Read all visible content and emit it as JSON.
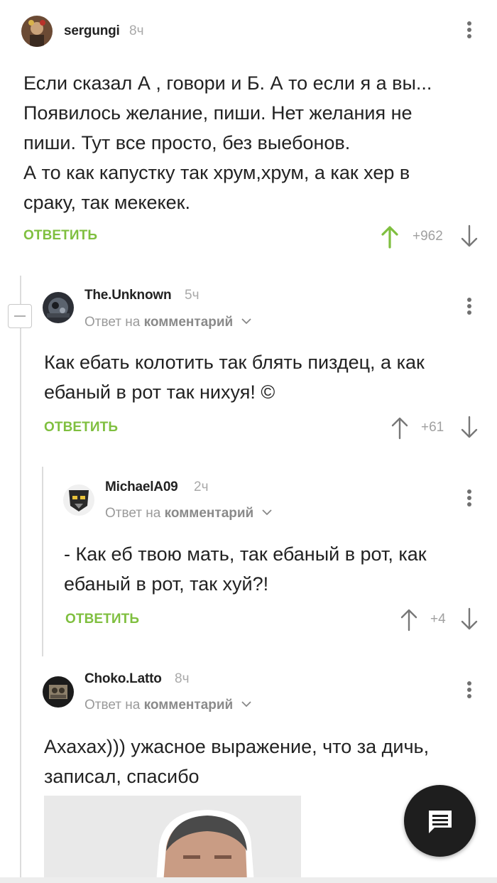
{
  "comments": [
    {
      "username": "sergungi",
      "time": "8ч",
      "lines": [
        "Если сказал А , говори и Б. А то если я а вы...",
        "Появилось желание, пиши. Нет желания не",
        "пиши. Тут все просто, без выебонов.",
        "А то как капустку так хрум,хрум, а как хер в",
        "сраку, так мекекек."
      ],
      "reply_label": "ОТВЕТИТЬ",
      "score": "+962",
      "upvoted": true
    },
    {
      "username": "The.Unknown",
      "time": "5ч",
      "reply_prefix": "Ответ на",
      "reply_target": "комментарий",
      "lines": [
        "Как ебать колотить так блять пиздец, а как",
        "ебаный в рот так нихуя! ©"
      ],
      "reply_label": "ОТВЕТИТЬ",
      "score": "+61"
    },
    {
      "username": "MichaelA09",
      "time": "2ч",
      "reply_prefix": "Ответ на",
      "reply_target": "комментарий",
      "lines": [
        "- Как еб твою мать, так ебаный в рот, как",
        "ебаный в рот, так хуй?!"
      ],
      "reply_label": "ОТВЕТИТЬ",
      "score": "+4"
    },
    {
      "username": "Choko.Latto",
      "time": "8ч",
      "reply_prefix": "Ответ на",
      "reply_target": "комментарий",
      "lines": [
        "Ахахах))) ужасное выражение, что за дичь,",
        "записал, спасибо"
      ]
    }
  ],
  "icons": {
    "upvote": "arrow-up-icon",
    "downvote": "arrow-down-icon",
    "more": "more-vertical-icon",
    "collapse": "collapse-thread-icon",
    "fab": "comments-icon"
  },
  "colors": {
    "accent_green": "#7fbf3f",
    "muted_gray": "#a0a0a0",
    "fab_bg": "#1e1e1e"
  }
}
